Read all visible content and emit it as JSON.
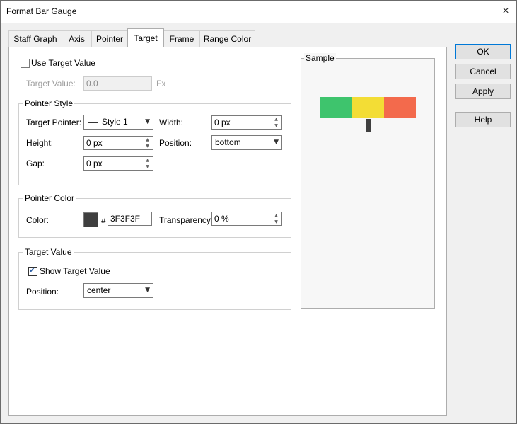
{
  "window": {
    "title": "Format Bar Gauge",
    "close_icon": "×"
  },
  "tabs": [
    {
      "label": "Staff Graph"
    },
    {
      "label": "Axis"
    },
    {
      "label": "Pointer"
    },
    {
      "label": "Target",
      "active": true
    },
    {
      "label": "Frame"
    },
    {
      "label": "Range Color"
    }
  ],
  "target_tab": {
    "use_target_value": {
      "label": "Use Target Value",
      "checked": false
    },
    "target_value": {
      "label": "Target Value:",
      "value": "0.0",
      "fx_label": "Fx",
      "enabled": false
    },
    "pointer_style": {
      "title": "Pointer Style",
      "target_pointer_label": "Target Pointer:",
      "target_pointer_value": "Style 1",
      "width_label": "Width:",
      "width_value": "0 px",
      "height_label": "Height:",
      "height_value": "0 px",
      "position_label": "Position:",
      "position_value": "bottom",
      "gap_label": "Gap:",
      "gap_value": "0 px"
    },
    "pointer_color": {
      "title": "Pointer Color",
      "color_label": "Color:",
      "hash": "#",
      "color_hex": "3F3F3F",
      "transparency_label": "Transparency:",
      "transparency_value": "0 %"
    },
    "target_value_group": {
      "title": "Target Value",
      "show_target_value_label": "Show Target Value",
      "show_target_value_checked": true,
      "position_label": "Position:",
      "position_value": "center"
    }
  },
  "sample": {
    "title": "Sample",
    "range_colors": [
      "#3ec46d",
      "#f3dd35",
      "#f36a4c"
    ],
    "pointer_color": "#3f3f3f"
  },
  "buttons": {
    "ok": "OK",
    "cancel": "Cancel",
    "apply": "Apply",
    "help": "Help"
  },
  "colors": {
    "pointer_swatch": "#3f3f3f",
    "accent": "#0078d7"
  }
}
